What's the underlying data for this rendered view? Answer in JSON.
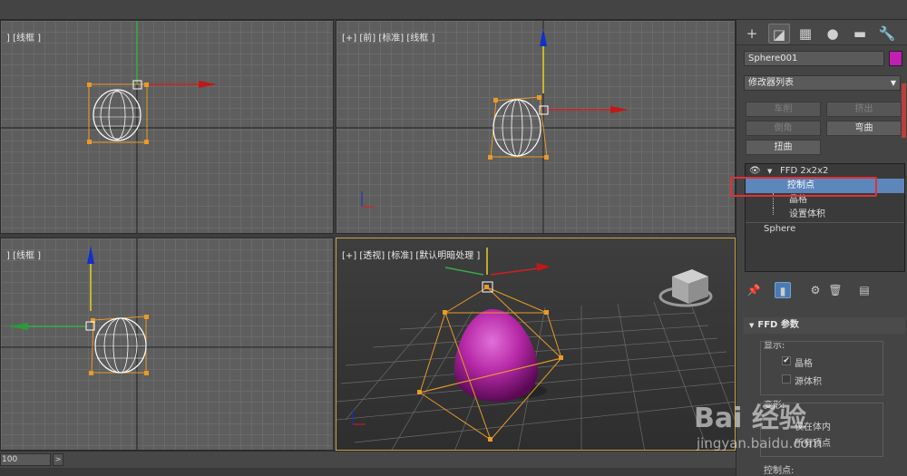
{
  "viewports": {
    "top_left_label": "] [线框 ]",
    "front_label": "[+] [前] [标准] [线框 ]",
    "left_label": "] [线框 ]",
    "perspective_label": "[+] [透视] [标准] [默认明暗处理 ]"
  },
  "command_panel": {
    "tabs": [
      {
        "icon": "plus-icon",
        "glyph": "+"
      },
      {
        "icon": "modify-icon",
        "glyph": "◪"
      },
      {
        "icon": "hierarchy-icon",
        "glyph": "▦"
      },
      {
        "icon": "motion-icon",
        "glyph": "●"
      },
      {
        "icon": "display-icon",
        "glyph": "▬"
      },
      {
        "icon": "utilities-icon",
        "glyph": "🔧"
      }
    ],
    "object_name": "Sphere001",
    "object_color": "#c21fb1",
    "modifier_list": "修改器列表",
    "buttons": {
      "extrude": "车削",
      "chamfer_edge": "挤出",
      "bevel": "倒角",
      "bend": "弯曲",
      "twist": "扭曲"
    },
    "stack": {
      "ffd": "FFD 2x2x2",
      "control_points": "控制点",
      "lattice": "晶格",
      "set_volume": "设置体积",
      "sphere": "Sphere"
    },
    "ffd_rollout": {
      "title": "FFD 参数",
      "display_label": "显示:",
      "lattice_label": "晶格",
      "source_volume_label": "源体积",
      "deform_label": "变形:",
      "only_in_volume": "仅在体内",
      "all_vertices": "所有顶点",
      "control_points_label": "控制点:"
    }
  },
  "timeline": {
    "frame_value": "100",
    "next_label": ">"
  },
  "watermark": {
    "brand": "Bai 经验",
    "url": "jingyan.baidu.com"
  }
}
